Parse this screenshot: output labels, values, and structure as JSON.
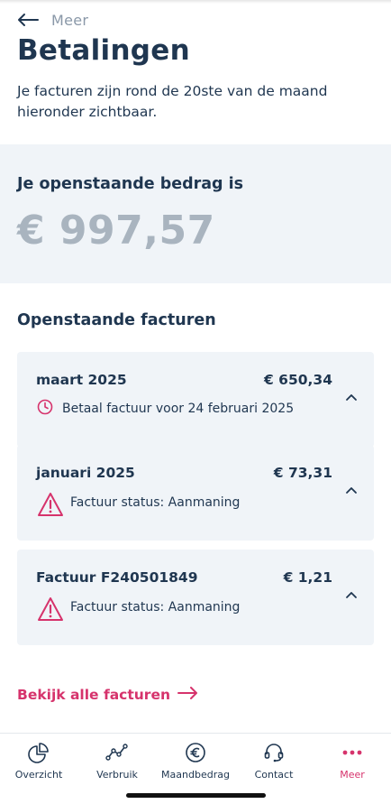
{
  "nav": {
    "back_label": "Meer"
  },
  "page": {
    "title": "Betalingen",
    "intro": "Je facturen zijn rond de 20ste van de maand hieronder zichtbaar."
  },
  "balance": {
    "label": "Je openstaande bedrag is",
    "amount": "€ 997,57"
  },
  "invoices": {
    "title": "Openstaande facturen",
    "items": [
      {
        "name": "maart 2025",
        "amount": "€ 650,34",
        "status": "Betaal factuur voor 24 februari 2025",
        "status_icon": "clock-icon"
      },
      {
        "name": "januari 2025",
        "amount": "€ 73,31",
        "status": "Factuur status: Aanmaning",
        "status_icon": "warning-icon"
      },
      {
        "name": "Factuur F240501849",
        "amount": "€ 1,21",
        "status": "Factuur status: Aanmaning",
        "status_icon": "warning-icon"
      }
    ],
    "view_all": "Bekijk alle facturen"
  },
  "tabbar": {
    "items": [
      {
        "label": "Overzicht",
        "icon": "pie-chart-icon"
      },
      {
        "label": "Verbruik",
        "icon": "line-graph-icon"
      },
      {
        "label": "Maandbedrag",
        "icon": "euro-coin-icon"
      },
      {
        "label": "Contact",
        "icon": "headset-icon"
      },
      {
        "label": "Meer",
        "icon": "more-dots-icon",
        "active": true
      }
    ]
  },
  "colors": {
    "text": "#1f3650",
    "accent": "#d6336c",
    "muted": "#a9b4bf",
    "panel": "#f0f4f8"
  }
}
